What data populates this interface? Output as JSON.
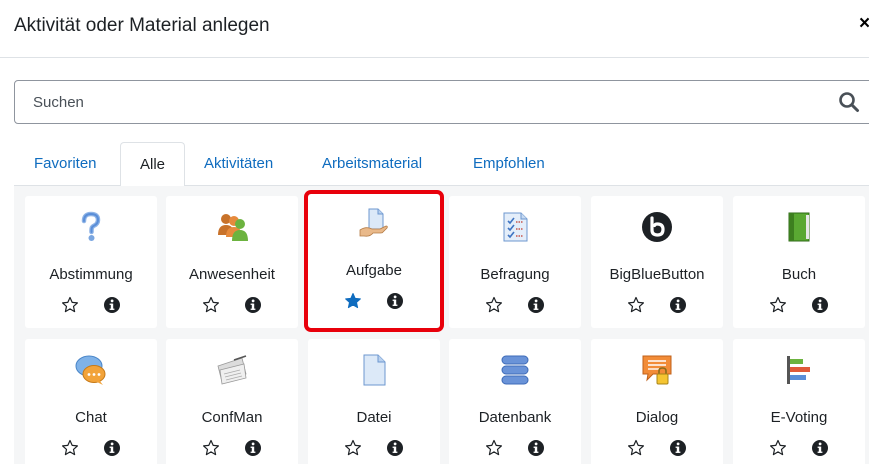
{
  "modal": {
    "title": "Aktivität oder Material anlegen",
    "close_label": "×"
  },
  "search": {
    "placeholder": "Suchen",
    "icon": "search-icon"
  },
  "tabs": [
    {
      "label": "Favoriten",
      "active": false
    },
    {
      "label": "Alle",
      "active": true
    },
    {
      "label": "Aktivitäten",
      "active": false
    },
    {
      "label": "Arbeitsmaterial",
      "active": false
    },
    {
      "label": "Empfohlen",
      "active": false
    }
  ],
  "colors": {
    "link": "#0f6cbf",
    "highlight": "#e8000b",
    "star_filled": "#0f6cbf",
    "grid_background": "#f5f6f7"
  },
  "modules": [
    {
      "label": "Abstimmung",
      "icon": "question-mark-icon",
      "favorite": false,
      "highlighted": false
    },
    {
      "label": "Anwesenheit",
      "icon": "people-group-icon",
      "favorite": false,
      "highlighted": false
    },
    {
      "label": "Aufgabe",
      "icon": "hand-document-icon",
      "favorite": true,
      "highlighted": true
    },
    {
      "label": "Befragung",
      "icon": "checklist-icon",
      "favorite": false,
      "highlighted": false
    },
    {
      "label": "BigBlueButton",
      "icon": "bigbluebutton-logo-icon",
      "favorite": false,
      "highlighted": false
    },
    {
      "label": "Buch",
      "icon": "book-icon",
      "favorite": false,
      "highlighted": false
    },
    {
      "label": "Chat",
      "icon": "chat-bubbles-icon",
      "favorite": false,
      "highlighted": false
    },
    {
      "label": "ConfMan",
      "icon": "papers-icon",
      "favorite": false,
      "highlighted": false
    },
    {
      "label": "Datei",
      "icon": "file-icon",
      "favorite": false,
      "highlighted": false
    },
    {
      "label": "Datenbank",
      "icon": "database-icon",
      "favorite": false,
      "highlighted": false
    },
    {
      "label": "Dialog",
      "icon": "dialog-lock-icon",
      "favorite": false,
      "highlighted": false
    },
    {
      "label": "E-Voting",
      "icon": "bar-chart-icon",
      "favorite": false,
      "highlighted": false
    }
  ]
}
